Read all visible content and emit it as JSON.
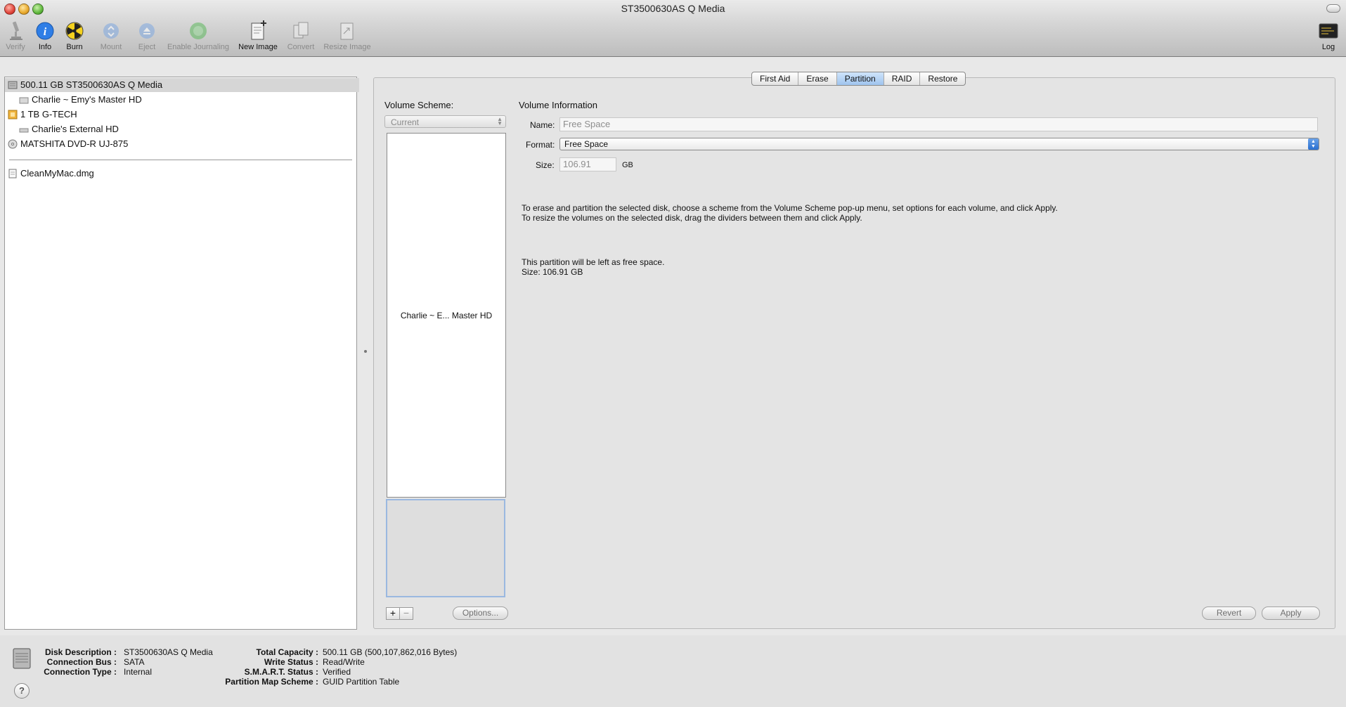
{
  "window": {
    "title": "ST3500630AS Q Media"
  },
  "toolbar": {
    "verify": "Verify",
    "info": "Info",
    "burn": "Burn",
    "mount": "Mount",
    "eject": "Eject",
    "enable_journaling": "Enable Journaling",
    "new_image": "New Image",
    "convert": "Convert",
    "resize_image": "Resize Image",
    "log": "Log"
  },
  "sidebar": {
    "items": [
      {
        "label": "500.11 GB ST3500630AS Q Media",
        "icon": "internal-disk-icon",
        "selected": true
      },
      {
        "label": "Charlie ~ Emy's Master HD",
        "icon": "volume-icon"
      },
      {
        "label": "1 TB G-TECH",
        "icon": "external-disk-icon"
      },
      {
        "label": "Charlie's External HD",
        "icon": "volume-icon"
      },
      {
        "label": "MATSHITA DVD-R UJ-875",
        "icon": "optical-drive-icon"
      },
      {
        "label": "CleanMyMac.dmg",
        "icon": "disk-image-icon"
      }
    ]
  },
  "tabs": [
    "First Aid",
    "Erase",
    "Partition",
    "RAID",
    "Restore"
  ],
  "active_tab": "Partition",
  "partition": {
    "volume_scheme_label": "Volume Scheme:",
    "scheme_value": "Current",
    "partition_1_label": "Charlie ~ E... Master HD",
    "add_symbol": "+",
    "remove_symbol": "−",
    "options_label": "Options..."
  },
  "volume_info": {
    "heading": "Volume Information",
    "name_label": "Name:",
    "name_placeholder": "Free Space",
    "format_label": "Format:",
    "format_value": "Free Space",
    "size_label": "Size:",
    "size_value": "106.91",
    "size_unit": "GB",
    "instructions_1": "To erase and partition the selected disk, choose a scheme from the Volume Scheme pop-up menu, set options for each volume, and click Apply.",
    "instructions_2": "To resize the volumes on the selected disk, drag the dividers between them and click Apply.",
    "free_note": "This partition will be left as free space.",
    "free_size": "Size: 106.91 GB",
    "revert_label": "Revert",
    "apply_label": "Apply"
  },
  "status": {
    "disk_description_label": "Disk Description :",
    "disk_description": "ST3500630AS Q Media",
    "connection_bus_label": "Connection Bus :",
    "connection_bus": "SATA",
    "connection_type_label": "Connection Type :",
    "connection_type": "Internal",
    "total_capacity_label": "Total Capacity :",
    "total_capacity": "500.11 GB (500,107,862,016 Bytes)",
    "write_status_label": "Write Status :",
    "write_status": "Read/Write",
    "smart_status_label": "S.M.A.R.T. Status :",
    "smart_status": "Verified",
    "partition_map_label": "Partition Map Scheme :",
    "partition_map": "GUID Partition Table",
    "help_symbol": "?"
  }
}
